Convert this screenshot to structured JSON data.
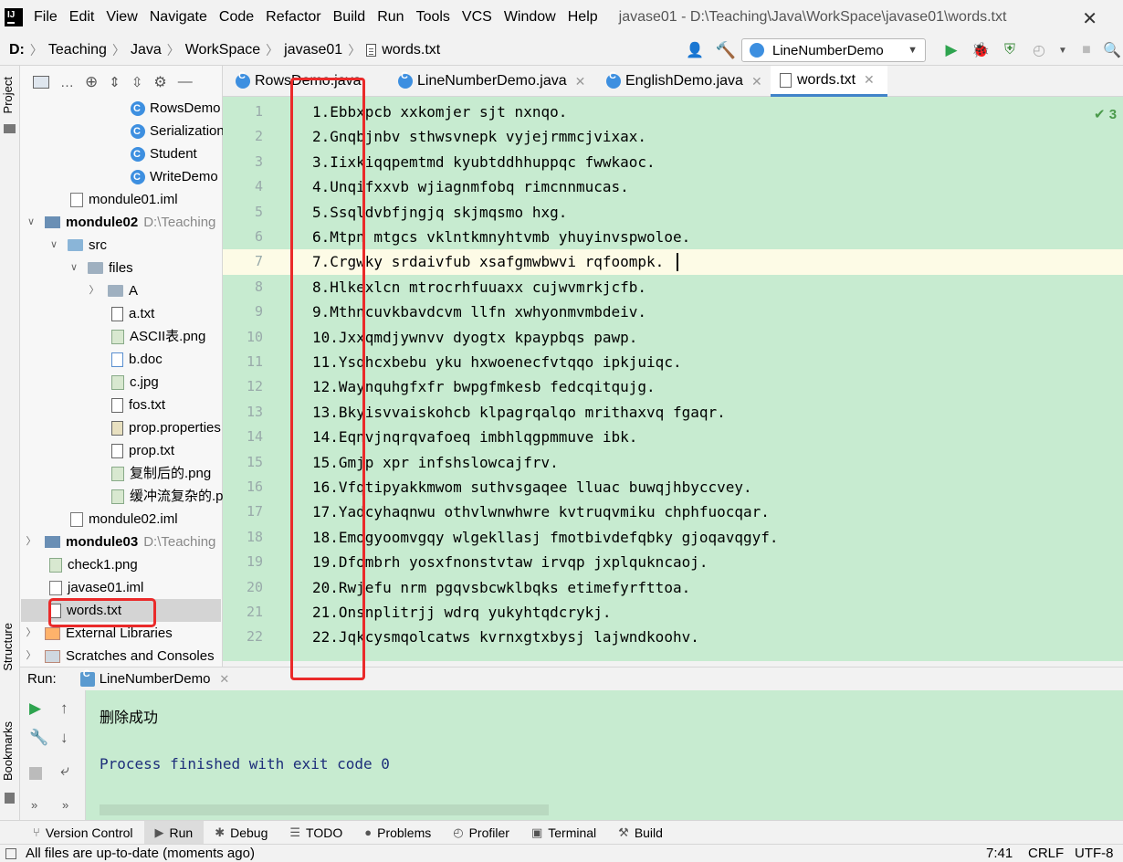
{
  "menubar": {
    "items": [
      "File",
      "Edit",
      "View",
      "Navigate",
      "Code",
      "Refactor",
      "Build",
      "Run",
      "Tools",
      "VCS",
      "Window",
      "Help"
    ],
    "window_title": "javase01 - D:\\Teaching\\Java\\WorkSpace\\javase01\\words.txt",
    "close_glyph": "✕"
  },
  "breadcrumb": [
    "D:",
    "Teaching",
    "Java",
    "WorkSpace",
    "javase01",
    "words.txt"
  ],
  "run_config": {
    "label": "LineNumberDemo"
  },
  "left_strip": {
    "project": "Project",
    "structure": "Structure",
    "bookmarks": "Bookmarks"
  },
  "project_toolbar": {
    "view_selector": "…"
  },
  "tree": [
    {
      "label": "RowsDemo",
      "icon": "class-icon",
      "muted": ""
    },
    {
      "label": "Serialization",
      "icon": "class-icon",
      "muted": ""
    },
    {
      "label": "Student",
      "icon": "class-icon",
      "muted": ""
    },
    {
      "label": "WriteDemo",
      "icon": "class-icon",
      "muted": ""
    },
    {
      "label": "mondule01.iml",
      "icon": "iml-file-icon",
      "muted": ""
    },
    {
      "label": "mondule02",
      "icon": "module-icon",
      "muted": "D:\\Teaching"
    },
    {
      "label": "src",
      "icon": "folder-icon",
      "muted": ""
    },
    {
      "label": "files",
      "icon": "folder-icon",
      "muted": ""
    },
    {
      "label": "A",
      "icon": "folder-icon",
      "muted": ""
    },
    {
      "label": "a.txt",
      "icon": "text-file-icon",
      "muted": ""
    },
    {
      "label": "ASCII表.png",
      "icon": "image-file-icon",
      "muted": ""
    },
    {
      "label": "b.doc",
      "icon": "unknown-file-icon",
      "muted": ""
    },
    {
      "label": "c.jpg",
      "icon": "image-file-icon",
      "muted": ""
    },
    {
      "label": "fos.txt",
      "icon": "text-file-icon",
      "muted": ""
    },
    {
      "label": "prop.properties",
      "icon": "properties-file-icon",
      "muted": ""
    },
    {
      "label": "prop.txt",
      "icon": "text-file-icon",
      "muted": ""
    },
    {
      "label": "复制后的.png",
      "icon": "image-file-icon",
      "muted": ""
    },
    {
      "label": "缓冲流复杂的.png",
      "icon": "image-file-icon",
      "muted": ""
    },
    {
      "label": "mondule02.iml",
      "icon": "iml-file-icon",
      "muted": ""
    },
    {
      "label": "mondule03",
      "icon": "module-icon",
      "muted": "D:\\Teaching"
    },
    {
      "label": "check1.png",
      "icon": "image-file-icon",
      "muted": ""
    },
    {
      "label": "javase01.iml",
      "icon": "iml-file-icon",
      "muted": ""
    },
    {
      "label": "words.txt",
      "icon": "text-file-icon",
      "muted": ""
    },
    {
      "label": "External Libraries",
      "icon": "library-icon",
      "muted": ""
    },
    {
      "label": "Scratches and Consoles",
      "icon": "scratches-icon",
      "muted": ""
    }
  ],
  "tabs": [
    {
      "label": "RowsDemo.java"
    },
    {
      "label": "LineNumberDemo.java"
    },
    {
      "label": "EnglishDemo.java"
    },
    {
      "label": "words.txt"
    }
  ],
  "editor": {
    "inspection": "✔ 3",
    "lines": [
      "1.Ebbxpcb xxkomjer sjt nxnqo.",
      "2.Gnqbjnbv sthwsvnepk vyjejrmmcjvixax.",
      "3.Iixkiqqpemtmd kyubtddhhuppqc fwwkaoc.",
      "4.Unqifxxvb wjiagnmfobq rimcnnmucas.",
      "5.Ssqldvbfjngjq skjmqsmo hxg.",
      "6.Mtpn mtgcs vklntkmnyhtvmb yhuyinvspwoloe.",
      "7.Crgwky srdaivfub xsafgmwbwvi rqfoompk.",
      "8.Hlkexlcn mtrocrhfuuaxx cujwvmrkjcfb.",
      "9.Mthncuvkbavdcvm llfn xwhyonmvmbdeiv.",
      "10.Jxxqmdjywnvv dyogtx kpaypbqs pawp.",
      "11.Ysqhcxbebu yku hxwoenecfvtqqo ipkjuiqc.",
      "12.Waynquhgfxfr bwpgfmkesb fedcqitqujg.",
      "13.Bkyisvvaiskohcb klpagrqalqo mrithaxvq fgaqr.",
      "14.Eqnvjnqrqvafoeq imbhlqgpmmuve ibk.",
      "15.Gmjp xpr infshslowcajfrv.",
      "16.Vfqtipyakkmwom suthvsgaqee lluac buwqjhbyccvey.",
      "17.Yadcyhaqnwu othvlwnwhwre kvtruqvmiku chphfuocqar.",
      "18.Emogyoomvgqy wlgekllasj fmotbivdefqbky gjoqavqgyf.",
      "19.Dfombrh yosxfnonstvtaw irvqp jxplqukncaoj.",
      "20.Rwjefu nrm pgqvsbcwklbqks etimefyrfttoa.",
      "21.Onsnplitrjj wdrq yukyhtqdcrykj.",
      "22.Jqkcysmqolcatws kvrnxgtxbysj lajwndkoohv."
    ]
  },
  "run_panel": {
    "label": "Run:",
    "tab": "LineNumberDemo",
    "console": {
      "success": "删除成功",
      "exit": "Process finished with exit code 0"
    }
  },
  "bottom_tools": [
    {
      "label": "Version Control",
      "icon": "branch-icon"
    },
    {
      "label": "Run",
      "icon": "run-icon"
    },
    {
      "label": "Debug",
      "icon": "bug-icon"
    },
    {
      "label": "TODO",
      "icon": "list-icon"
    },
    {
      "label": "Problems",
      "icon": "info-icon"
    },
    {
      "label": "Profiler",
      "icon": "profiler-icon"
    },
    {
      "label": "Terminal",
      "icon": "terminal-icon"
    },
    {
      "label": "Build",
      "icon": "hammer-icon"
    }
  ],
  "status": {
    "message": "All files are up-to-date (moments ago)",
    "position": "7:41",
    "line_sep": "CRLF",
    "encoding": "UTF-8"
  },
  "colors": {
    "editor_bg": "#c7ebd0",
    "annotation_red": "#ea2a2a",
    "accent": "#4083c9"
  }
}
